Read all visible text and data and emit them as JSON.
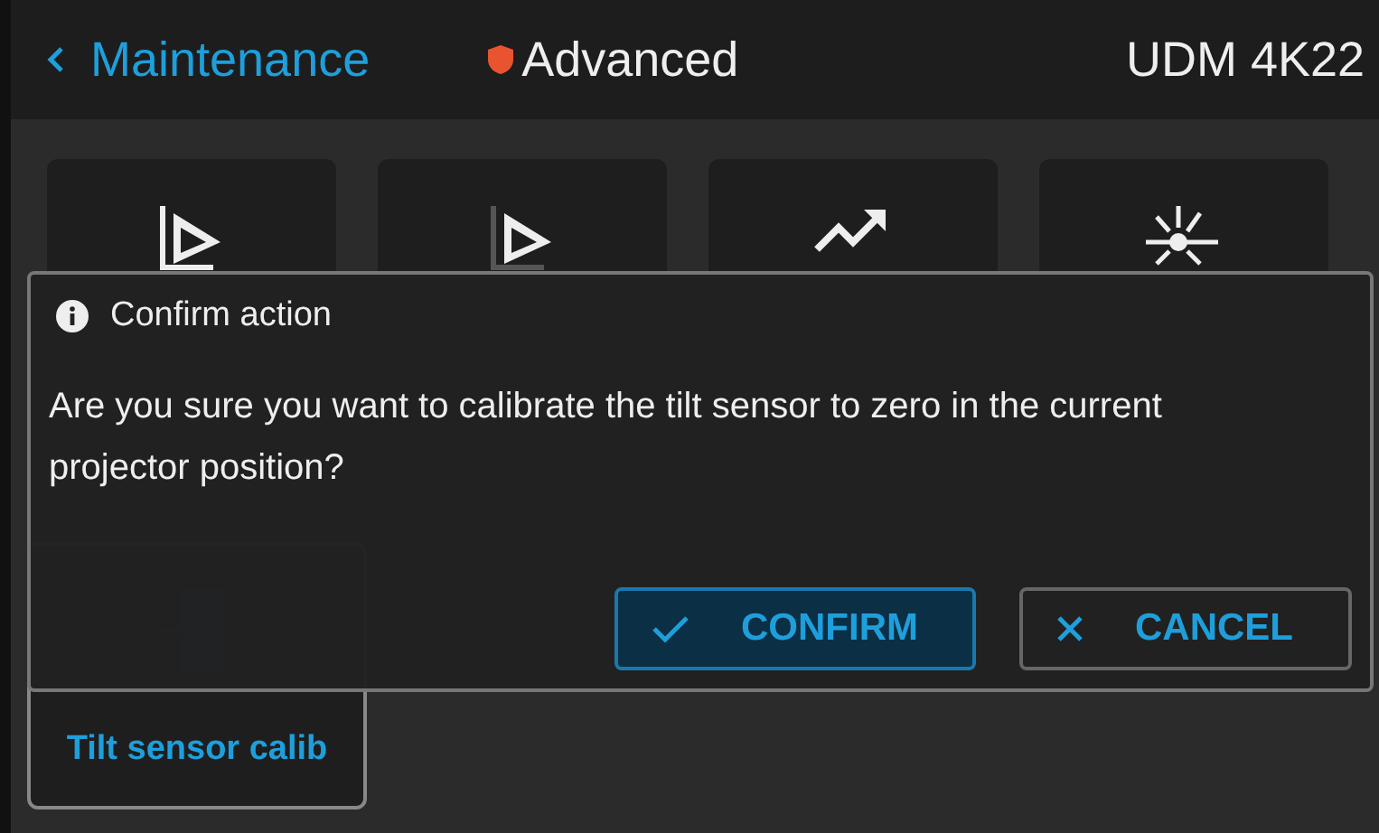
{
  "header": {
    "back_label": "Maintenance",
    "access_level": "Advanced",
    "device": "UDM 4K22"
  },
  "tiles": [
    {
      "selected": false
    },
    {
      "selected": false
    },
    {
      "selected": false
    },
    {
      "selected": false
    },
    {
      "label": "Tilt sensor calib",
      "selected": true
    }
  ],
  "dialog": {
    "title": "Confirm action",
    "message": "Are you sure you want to calibrate the tilt sensor to zero in the current projector position?",
    "buttons": [
      {
        "kind": "confirm",
        "label": "CONFIRM",
        "focused": true
      },
      {
        "kind": "cancel",
        "label": "CANCEL",
        "focused": false
      }
    ]
  }
}
